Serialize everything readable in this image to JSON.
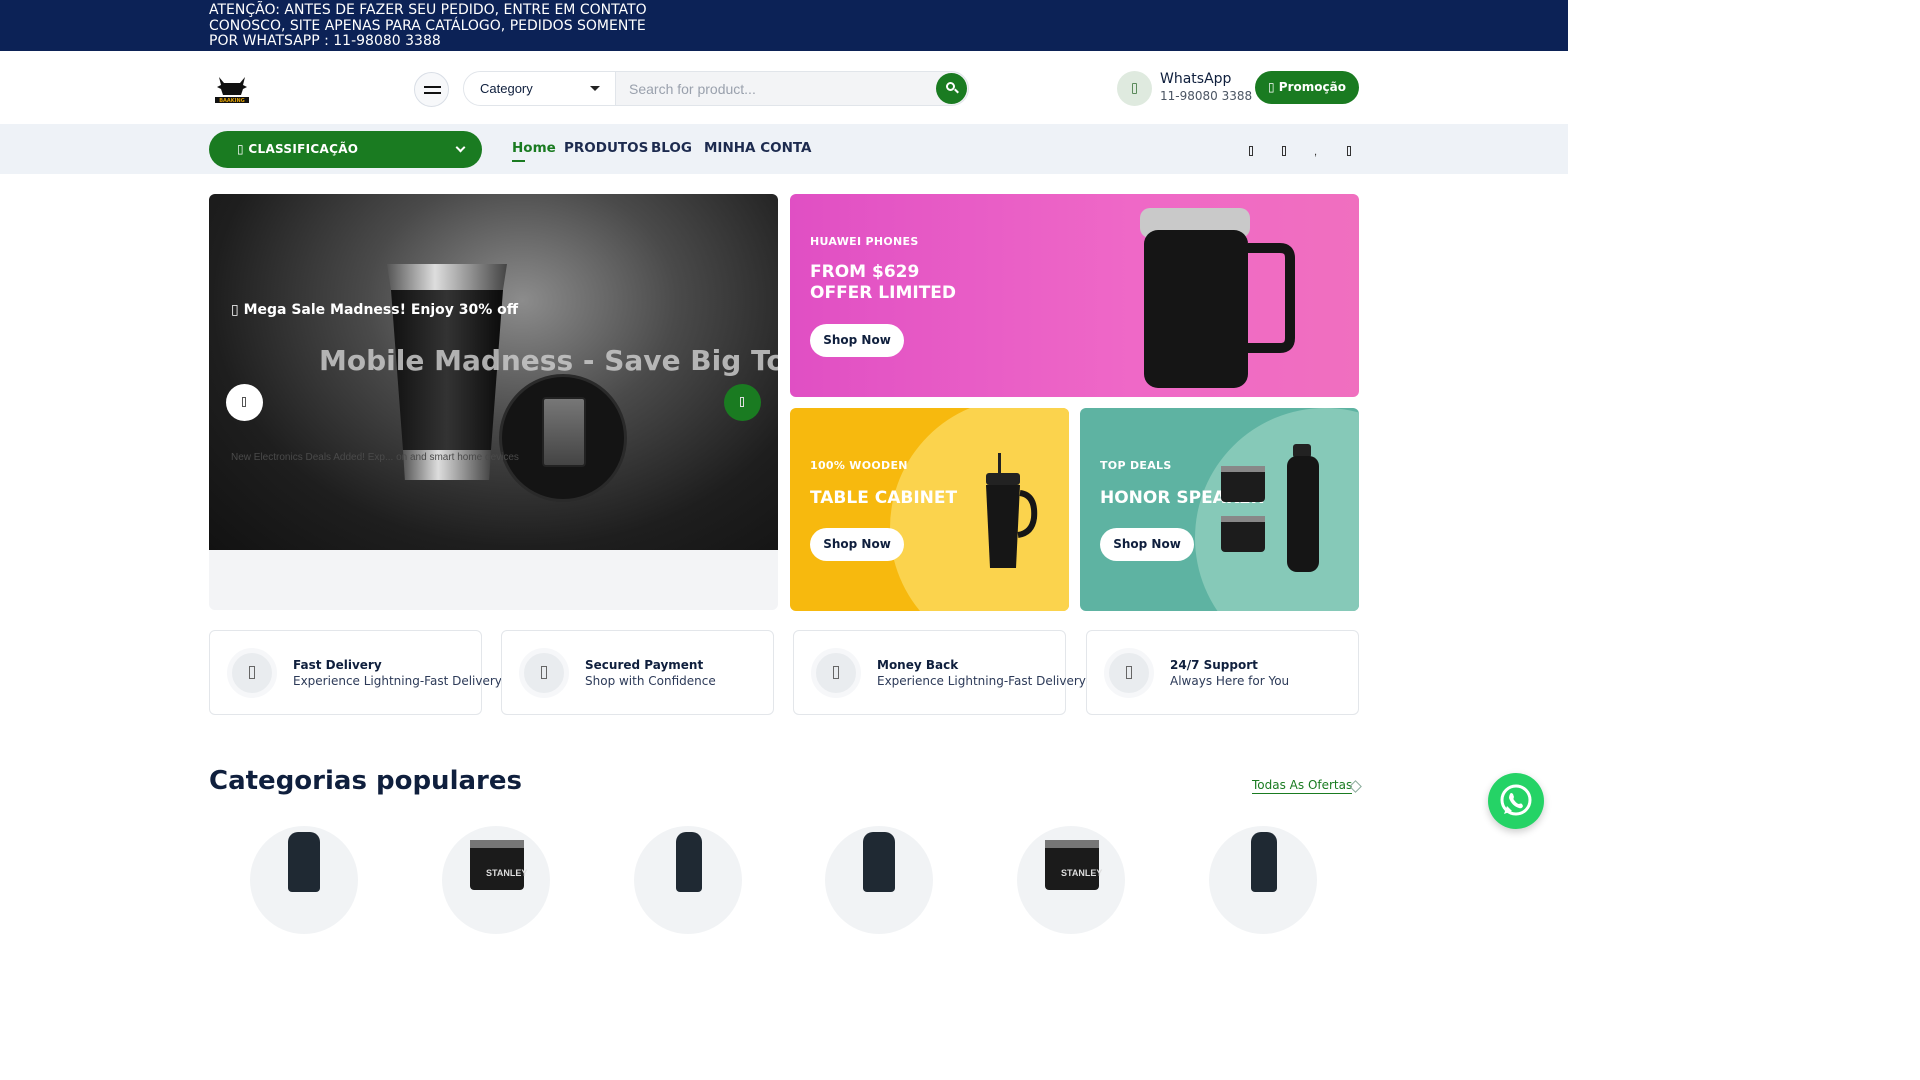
{
  "notice": {
    "text": "ATENÇÃO: ANTES DE FAZER SEU PEDIDO, ENTRE EM CONTATO CONOSCO, SITE APENAS PARA CATÁLOGO, PEDIDOS SOMENTE POR WHATSAPP  : 11-98080 3388"
  },
  "header": {
    "logo_text": "BAAKING",
    "category_select": "Category",
    "search_placeholder": "Search for product...",
    "whatsapp_title": "WhatsApp",
    "whatsapp_phone": "11-98080 3388",
    "promo_button": "Promoção"
  },
  "nav": {
    "classification": "CLASSIFICAÇÃO",
    "links": [
      "Home",
      "PRODUTOS",
      "BLOG",
      "MINHA CONTA"
    ],
    "active": "Home"
  },
  "hero": {
    "tag": "Mega Sale Madness! Enjoy 30% off",
    "title": "Mobile Madness - Save Big Toda",
    "subtitle": "New Electronics Deals Added! Exp... on and smart home devices"
  },
  "cards": [
    {
      "kicker": "HUAWEI PHONES",
      "title_line1": "FROM $629",
      "title_line2": "OFFER LIMITED",
      "button": "Shop Now",
      "color": "#e04fc4"
    },
    {
      "kicker": "100% WOODEN",
      "title_line1": "TABLE CABINET",
      "button": "Shop Now",
      "color": "#f7b90e"
    },
    {
      "kicker": "TOP DEALS",
      "title_line1": "HONOR SPEAKER",
      "button": "Shop Now",
      "color": "#5eb3a2"
    }
  ],
  "features": [
    {
      "title": "Fast Delivery",
      "subtitle": "Experience Lightning-Fast Delivery"
    },
    {
      "title": "Secured Payment",
      "subtitle": "Shop with Confidence"
    },
    {
      "title": "Money Back",
      "subtitle": "Experience Lightning-Fast Delivery"
    },
    {
      "title": "24/7 Support",
      "subtitle": "Always Here for You"
    }
  ],
  "categories": {
    "heading": "Categorias populares",
    "all_offers": "Todas As Ofertas",
    "items": [
      "bottle",
      "stanley-cup",
      "bottle-cap",
      "bottle",
      "stanley-cup",
      "bottle-cap"
    ],
    "product_label": "STANLEY"
  },
  "colors": {
    "brand_green": "#1a7b21",
    "navy": "#0c2256",
    "whatsapp": "#25d366"
  }
}
